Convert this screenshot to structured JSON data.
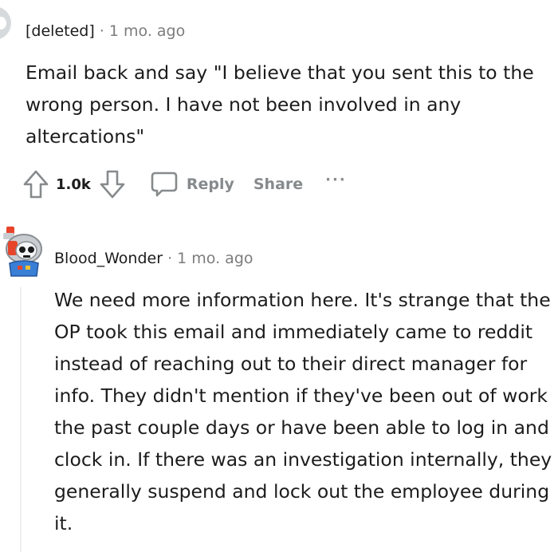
{
  "comments": [
    {
      "author": "[deleted]",
      "separator": "·",
      "time": "1 mo. ago",
      "body": "Email back and say \"I believe that you sent this to the wrong person. I have not been involved in any altercations\"",
      "votes": "1.0k",
      "actions": {
        "reply_label": "Reply",
        "share_label": "Share",
        "more_label": "···"
      },
      "icons": {
        "upvote": "upvote-arrow-icon",
        "downvote": "downvote-arrow-icon",
        "reply": "speech-bubble-icon",
        "more": "ellipsis-icon"
      }
    },
    {
      "author": "Blood_Wonder",
      "separator": "·",
      "time": "1 mo. ago",
      "body": "We need more information here. It's strange that the OP took this email and immediately came to reddit instead of reaching out to their direct manager for info. They didn't mention if they've been out of work the past couple days or have been able to log in and clock in. If there was an investigation internally, they generally suspend and lock out the employee during it.",
      "avatar": "robot-avatar"
    }
  ],
  "colors": {
    "text": "#1c1c1c",
    "meta": "#7c7c7c",
    "action": "#878a8c",
    "thread_line": "#edeff1"
  }
}
